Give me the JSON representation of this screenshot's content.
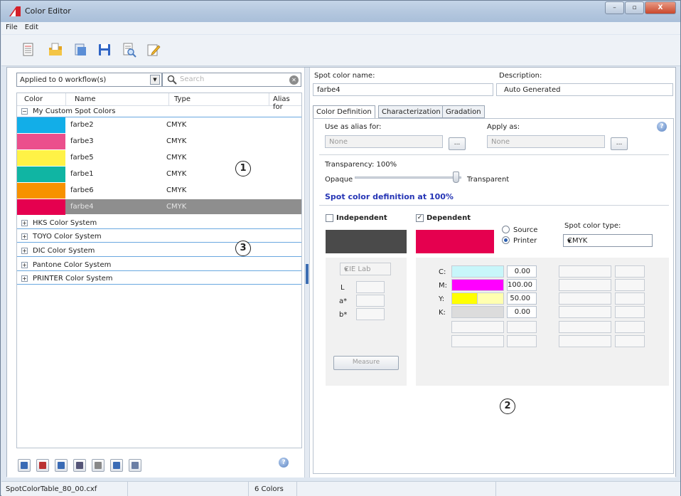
{
  "window": {
    "title": "Color Editor",
    "min": "–",
    "max": "▫",
    "close": "X"
  },
  "menu": [
    "File",
    "Edit"
  ],
  "left": {
    "workflow_select": "Applied to 0 workflow(s)",
    "search_placeholder": "Search",
    "columns": [
      "Color",
      "Name",
      "Type",
      "Alias for"
    ],
    "groups": [
      {
        "label": "My Custom Spot Colors",
        "sign": "−"
      },
      {
        "label": "HKS Color System",
        "sign": "+"
      },
      {
        "label": "TOYO Color System",
        "sign": "+"
      },
      {
        "label": "DIC Color System",
        "sign": "+"
      },
      {
        "label": "Pantone Color System",
        "sign": "+"
      },
      {
        "label": "PRINTER Color System",
        "sign": "+"
      }
    ],
    "rows": [
      {
        "color": "#12aee8",
        "name": "farbe2",
        "type": "CMYK"
      },
      {
        "color": "#eb4f8c",
        "name": "farbe3",
        "type": "CMYK"
      },
      {
        "color": "#fff246",
        "name": "farbe5",
        "type": "CMYK"
      },
      {
        "color": "#10b5a3",
        "name": "farbe1",
        "type": "CMYK"
      },
      {
        "color": "#f79200",
        "name": "farbe6",
        "type": "CMYK"
      },
      {
        "color": "#e5004f",
        "name": "farbe4",
        "type": "CMYK"
      }
    ]
  },
  "callouts": [
    "1",
    "2",
    "3"
  ],
  "right": {
    "spot_name_label": "Spot color name:",
    "spot_name_value": "farbe4",
    "description_label": "Description:",
    "description_value": "Auto Generated",
    "tabs": [
      "Color Definition",
      "Characterization",
      "Gradation"
    ],
    "alias_label": "Use as alias for:",
    "alias_value": "None",
    "apply_label": "Apply as:",
    "apply_value": "None",
    "dots": "...",
    "transparency_label": "Transparency: 100%",
    "transparency_value": 100,
    "opaque": "Opaque",
    "transparent": "Transparent",
    "spot_def_heading": "Spot color definition at 100%",
    "independent": "Independent",
    "dependent": "Dependent",
    "source": "Source",
    "printer": "Printer",
    "spot_type_label": "Spot color type:",
    "spot_type_value": "CMYK",
    "cie": "CIE Lab",
    "lab_labels": [
      "L",
      "a*",
      "b*"
    ],
    "measure": "Measure",
    "cmyk": [
      {
        "label": "C:",
        "value": "0.00",
        "color": "#c8f6fa",
        "fill": 1.0
      },
      {
        "label": "M:",
        "value": "100.00",
        "color": "#ff00ff",
        "fill": 1.0
      },
      {
        "label": "Y:",
        "value": "50.00",
        "color": "#ffff00",
        "fill": 0.5
      },
      {
        "label": "K:",
        "value": "0.00",
        "color": "#dcdcdc",
        "fill": 1.0
      }
    ]
  },
  "status": {
    "file": "SpotColorTable_80_00.cxf",
    "count": "6 Colors"
  }
}
